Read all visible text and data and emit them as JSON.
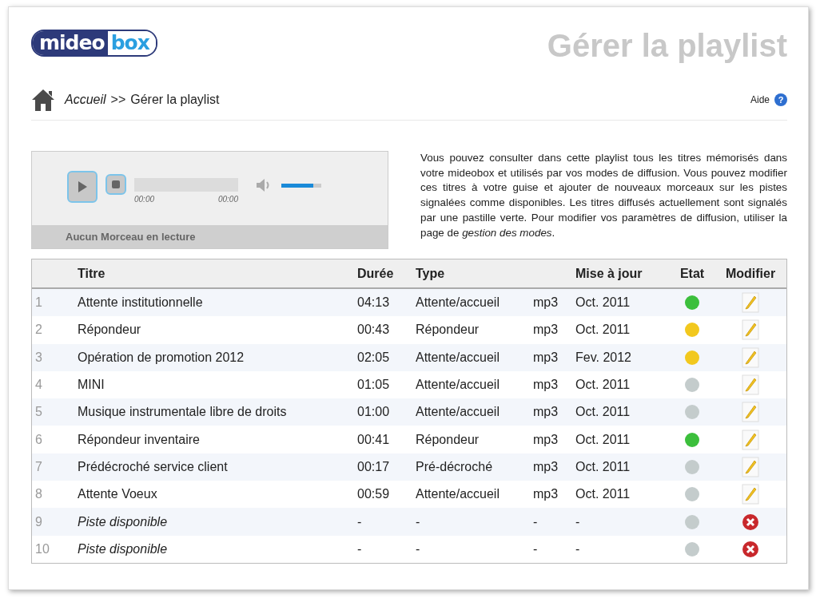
{
  "logo": {
    "dark_part": "mideo",
    "light_part": "box"
  },
  "page_title": "Gérer la playlist",
  "breadcrumb": {
    "home": "Accueil",
    "separator": ">>",
    "current": "Gérer la playlist"
  },
  "help": {
    "label": "Aide",
    "icon_glyph": "?"
  },
  "player": {
    "time_start": "00:00",
    "time_end": "00:00",
    "volume": {
      "level": 0.8
    },
    "status": "Aucun Morceau en lecture"
  },
  "description": "Vous pouvez consulter dans cette playlist tous les titres mémorisés dans votre mideobox et utilisés par vos modes de diffusion. Vous pouvez modifier ces titres à votre guise et ajouter de nouveaux morceaux sur les pistes signalées comme disponibles. Les titres diffusés actuellement sont signalés par une pastille verte. Pour modifier vos paramètres de diffusion, utiliser la page de *gestion des modes*.",
  "table": {
    "columns": {
      "title": "Titre",
      "duration": "Durée",
      "type": "Type",
      "updated": "Mise à jour",
      "state": "Etat",
      "edit": "Modifier"
    },
    "rows": [
      {
        "kind": "track",
        "number": "1",
        "title": "Attente institutionnelle",
        "duration": "04:13",
        "type": "Attente/accueil",
        "format": "mp3",
        "updated": "Oct. 2011",
        "color": "#3cbf3c"
      },
      {
        "kind": "track",
        "number": "2",
        "title": "Répondeur",
        "duration": "00:43",
        "type": "Répondeur",
        "format": "mp3",
        "updated": "Oct. 2011",
        "color": "#f2c81e"
      },
      {
        "kind": "track",
        "number": "3",
        "title": "Opération de promotion 2012",
        "duration": "02:05",
        "type": "Attente/accueil",
        "format": "mp3",
        "updated": "Fev. 2012",
        "color": "#f2c81e"
      },
      {
        "kind": "track",
        "number": "4",
        "title": "MINI",
        "duration": "01:05",
        "type": "Attente/accueil",
        "format": "mp3",
        "updated": "Oct. 2011",
        "color": "#c4cccc"
      },
      {
        "kind": "track",
        "number": "5",
        "title": "Musique instrumentale libre de droits",
        "duration": "01:00",
        "type": "Attente/accueil",
        "format": "mp3",
        "updated": "Oct. 2011",
        "color": "#c4cccc"
      },
      {
        "kind": "track",
        "number": "6",
        "title": "Répondeur inventaire",
        "duration": "00:41",
        "type": "Répondeur",
        "format": "mp3",
        "updated": "Oct. 2011",
        "color": "#3cbf3c"
      },
      {
        "kind": "track",
        "number": "7",
        "title": "Prédécroché service client",
        "duration": "00:17",
        "type": "Pré-décroché",
        "format": "mp3",
        "updated": "Oct. 2011",
        "color": "#c4cccc"
      },
      {
        "kind": "track",
        "number": "8",
        "title": "Attente Voeux",
        "duration": "00:59",
        "type": "Attente/accueil",
        "format": "mp3",
        "updated": "Oct. 2011",
        "color": "#c4cccc"
      },
      {
        "kind": "available",
        "number": "9",
        "title": "Piste disponible",
        "duration": "-",
        "type": "-",
        "format": "-",
        "updated": "-",
        "color": "#c4cccc"
      },
      {
        "kind": "available",
        "number": "10",
        "title": "Piste disponible",
        "duration": "-",
        "type": "-",
        "format": "-",
        "updated": "-",
        "color": "#c4cccc"
      }
    ]
  }
}
